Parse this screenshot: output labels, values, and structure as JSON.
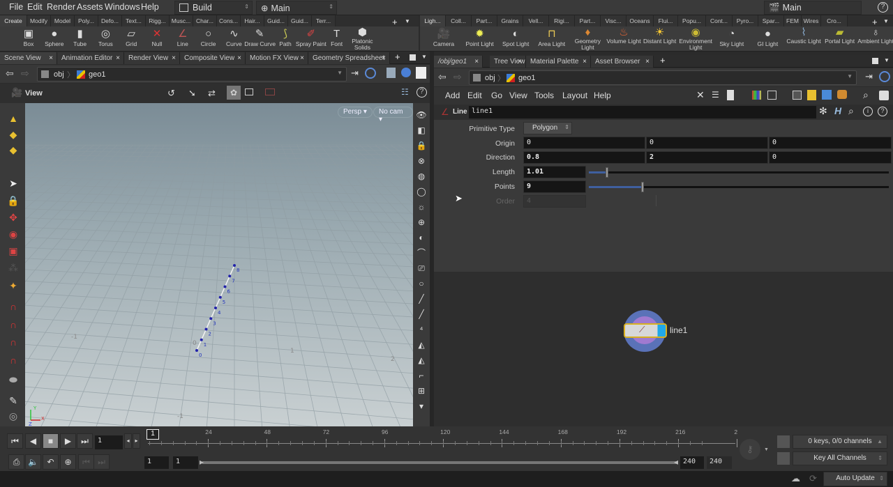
{
  "menubar": {
    "items": [
      "File",
      "Edit",
      "Render",
      "Assets",
      "Windows",
      "Help"
    ],
    "desktop": "Build",
    "context": "Main",
    "right_context": "Main"
  },
  "shelf_left": {
    "tabs": [
      "Create",
      "Modify",
      "Model",
      "Poly...",
      "Defo...",
      "Text...",
      "Rigg...",
      "Musc...",
      "Char...",
      "Cons...",
      "Hair...",
      "Guid...",
      "Guid...",
      "Terr..."
    ],
    "active_tab": "Create",
    "tools": [
      {
        "label": "Box",
        "icon": "box-icon"
      },
      {
        "label": "Sphere",
        "icon": "sphere-icon"
      },
      {
        "label": "Tube",
        "icon": "tube-icon"
      },
      {
        "label": "Torus",
        "icon": "torus-icon"
      },
      {
        "label": "Grid",
        "icon": "grid-icon"
      },
      {
        "label": "Null",
        "icon": "null-icon"
      },
      {
        "label": "Line",
        "icon": "line-icon"
      },
      {
        "label": "Circle",
        "icon": "circle-icon"
      },
      {
        "label": "Curve",
        "icon": "curve-icon"
      },
      {
        "label": "Draw Curve",
        "icon": "draw-curve-icon"
      },
      {
        "label": "Path",
        "icon": "path-icon"
      },
      {
        "label": "Spray Paint",
        "icon": "spray-paint-icon"
      },
      {
        "label": "Font",
        "icon": "font-icon"
      },
      {
        "label": "Platonic Solids",
        "icon": "platonic-solids-icon"
      }
    ]
  },
  "shelf_right": {
    "tabs": [
      "Ligh...",
      "Coll...",
      "Part...",
      "Grains",
      "Vell...",
      "Rigi...",
      "Part...",
      "Visc...",
      "Oceans",
      "Flui...",
      "Popu...",
      "Cont...",
      "Pyro...",
      "Spar...",
      "FEM",
      "Wires",
      "Cro..."
    ],
    "active_tab": "Ligh...",
    "tools": [
      {
        "label": "Camera",
        "icon": "camera-icon"
      },
      {
        "label": "Point Light",
        "icon": "point-light-icon"
      },
      {
        "label": "Spot Light",
        "icon": "spot-light-icon"
      },
      {
        "label": "Area Light",
        "icon": "area-light-icon"
      },
      {
        "label": "Geometry Light",
        "icon": "geometry-light-icon"
      },
      {
        "label": "Volume Light",
        "icon": "volume-light-icon"
      },
      {
        "label": "Distant Light",
        "icon": "distant-light-icon"
      },
      {
        "label": "Environment Light",
        "icon": "environment-light-icon"
      },
      {
        "label": "Sky Light",
        "icon": "sky-light-icon"
      },
      {
        "label": "GI Light",
        "icon": "gi-light-icon"
      },
      {
        "label": "Caustic Light",
        "icon": "caustic-light-icon"
      },
      {
        "label": "Portal Light",
        "icon": "portal-light-icon"
      },
      {
        "label": "Ambient Light",
        "icon": "ambient-light-icon"
      }
    ]
  },
  "left_pane": {
    "tabs": [
      "Scene View",
      "Animation Editor",
      "Render View",
      "Composite View",
      "Motion FX View",
      "Geometry Spreadsheet"
    ],
    "active_tab": "Scene View",
    "path": [
      "obj",
      "geo1"
    ],
    "view_label": "View",
    "persp_label": "Persp",
    "cam_label": "No cam",
    "point_numbers": [
      "0",
      "1",
      "2",
      "3",
      "4",
      "5",
      "6",
      "7",
      "8"
    ],
    "grid_labels": [
      "-1",
      "0",
      "1",
      "2",
      "-1"
    ],
    "axis_labels": {
      "x": "X",
      "y": "Y",
      "z": "Z"
    }
  },
  "right_pane": {
    "tabs": [
      "/obj/geo1",
      "Tree View",
      "Material Palette",
      "Asset Browser"
    ],
    "active_tab": "/obj/geo1",
    "path": [
      "obj",
      "geo1"
    ],
    "menu": [
      "Add",
      "Edit",
      "Go",
      "View",
      "Tools",
      "Layout",
      "Help"
    ],
    "node_type": "Line",
    "node_name": "line1",
    "params": {
      "primitive_type_label": "Primitive Type",
      "primitive_type_value": "Polygon",
      "origin_label": "Origin",
      "origin": [
        "0",
        "0",
        "0"
      ],
      "direction_label": "Direction",
      "direction": [
        "0.8",
        "2",
        "0"
      ],
      "length_label": "Length",
      "length": "1.01",
      "length_slider_fraction": 0.06,
      "points_label": "Points",
      "points": "9",
      "points_slider_fraction": 0.18,
      "order_label": "Order",
      "order": "4"
    },
    "network_node_label": "line1"
  },
  "timeline": {
    "current_frame": "1",
    "frame_marker": "1",
    "ticks": [
      "24",
      "48",
      "72",
      "96",
      "120",
      "144",
      "168",
      "192",
      "216",
      "2"
    ],
    "range_start": "1",
    "range_start2": "1",
    "range_end": "240",
    "range_end2": "240",
    "keys_status": "0 keys, 0/0 channels",
    "key_mode": "Key All Channels"
  },
  "statusbar": {
    "update_mode": "Auto Update"
  }
}
